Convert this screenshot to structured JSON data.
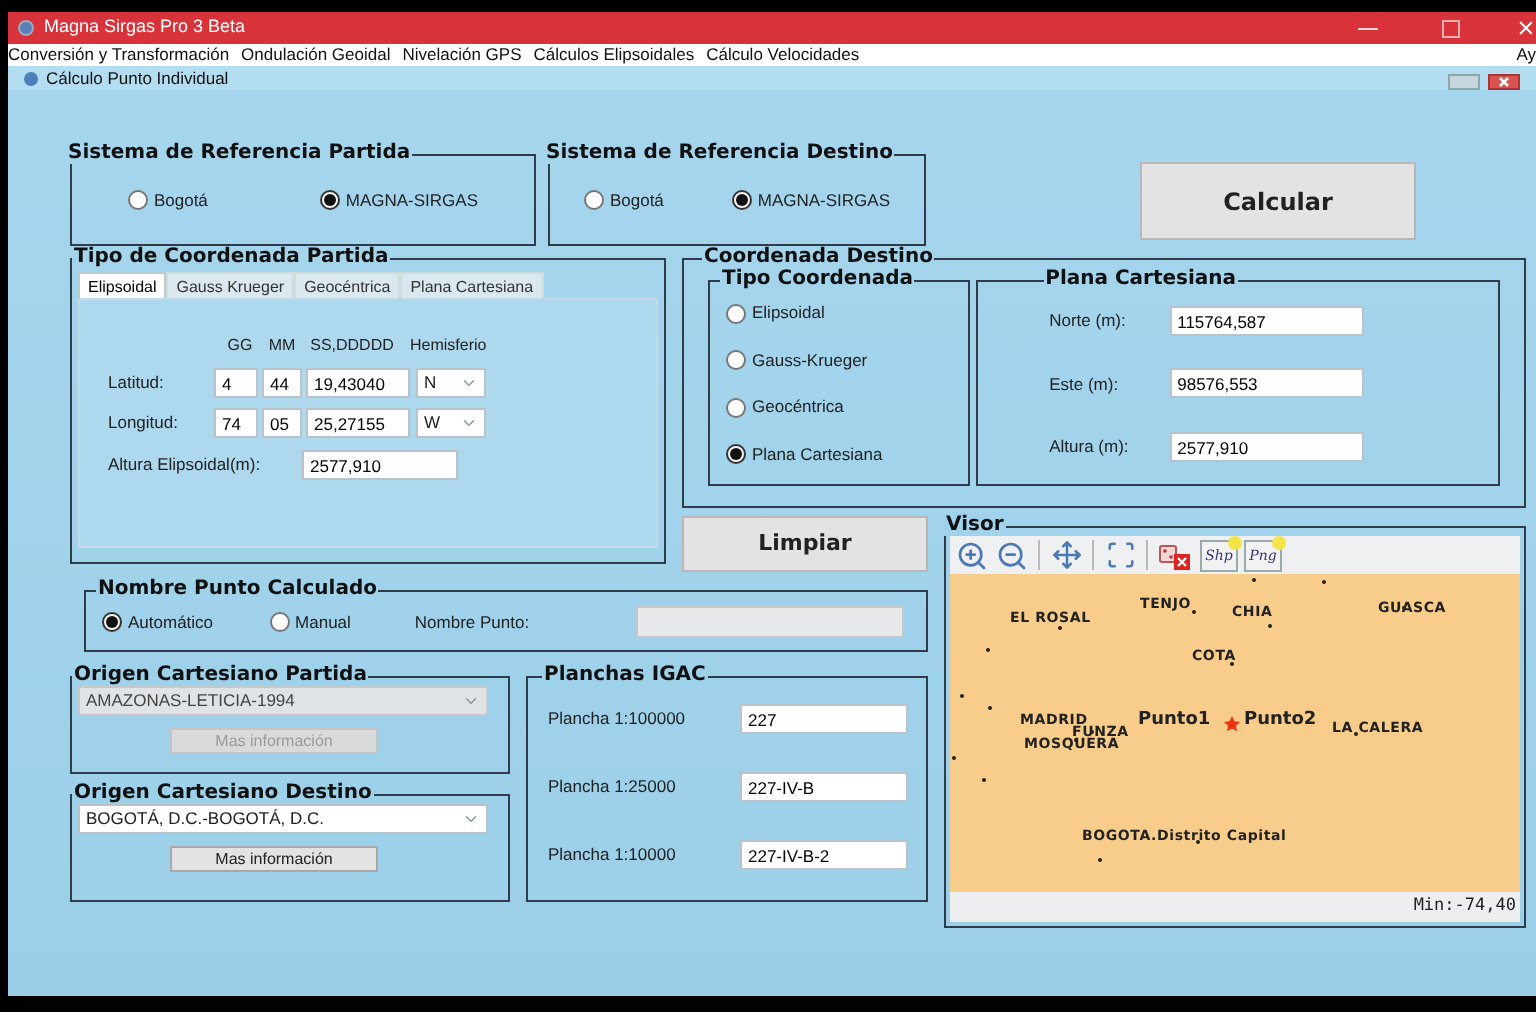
{
  "window": {
    "title": "Magna Sirgas Pro 3 Beta"
  },
  "menu": [
    "Conversión y Transformación",
    "Ondulación Geoidal",
    "Nivelación GPS",
    "Cálculos Elipsoidales",
    "Cálculo Velocidades",
    "Ay"
  ],
  "subwindow": {
    "title": "Cálculo Punto Individual"
  },
  "ref_partida": {
    "title": "Sistema de Referencia Partida",
    "options": [
      {
        "label": "Bogotá",
        "selected": false
      },
      {
        "label": "MAGNA-SIRGAS",
        "selected": true
      }
    ]
  },
  "ref_destino": {
    "title": "Sistema de Referencia Destino",
    "options": [
      {
        "label": "Bogotá",
        "selected": false
      },
      {
        "label": "MAGNA-SIRGAS",
        "selected": true
      }
    ]
  },
  "calcular": "Calcular",
  "tipo_partida": {
    "title": "Tipo de Coordenada Partida",
    "tabs": [
      {
        "label": "Elipsoidal",
        "selected": true
      },
      {
        "label": "Gauss Krueger",
        "selected": false
      },
      {
        "label": "Geocéntrica",
        "selected": false
      },
      {
        "label": "Plana Cartesiana",
        "selected": false
      }
    ],
    "headers": [
      "GG",
      "MM",
      "SS,DDDDD",
      "Hemisferio"
    ],
    "rows": [
      {
        "label": "Latitud:",
        "gg": "4",
        "mm": "44",
        "ss": "19,43040",
        "hemisferio": "N"
      },
      {
        "label": "Longitud:",
        "gg": "74",
        "mm": "05",
        "ss": "25,27155",
        "hemisferio": "W"
      }
    ],
    "altura": {
      "label": "Altura Elipsoidal(m):",
      "value": "2577,910"
    }
  },
  "destino": {
    "title": "Coordenada Destino",
    "tipo": {
      "title": "Tipo Coordenada",
      "options": [
        {
          "label": "Elipsoidal",
          "selected": false
        },
        {
          "label": "Gauss-Krueger",
          "selected": false
        },
        {
          "label": "Geocéntrica",
          "selected": false
        },
        {
          "label": "Plana Cartesiana",
          "selected": true
        }
      ]
    },
    "plana": {
      "title": "Plana Cartesiana",
      "fields": [
        {
          "label": "Norte (m):",
          "value": "115764,587"
        },
        {
          "label": "Este (m):",
          "value": "98576,553"
        },
        {
          "label": "Altura (m):",
          "value": "2577,910"
        }
      ]
    }
  },
  "limpiar": "Limpiar",
  "nombre_punto": {
    "title": "Nombre Punto Calculado",
    "options": [
      {
        "label": "Automático",
        "selected": true
      },
      {
        "label": "Manual",
        "selected": false
      }
    ],
    "field_label": "Nombre Punto:",
    "field_disabled": true
  },
  "origen_partida": {
    "title": "Origen Cartesiano Partida",
    "value": "AMAZONAS-LETICIA-1994",
    "button": "Mas información",
    "disabled": true
  },
  "origen_destino": {
    "title": "Origen Cartesiano Destino",
    "value": "BOGOTÁ, D.C.-BOGOTÁ, D.C.",
    "button": "Mas información",
    "disabled": false
  },
  "planchas": {
    "title": "Planchas IGAC",
    "rows": [
      {
        "label": "Plancha 1:100000",
        "value": "227"
      },
      {
        "label": "Plancha 1:25000",
        "value": "227-IV-B"
      },
      {
        "label": "Plancha 1:10000",
        "value": "227-IV-B-2"
      }
    ]
  },
  "visor": {
    "title": "Visor",
    "tools": [
      {
        "kind": "zoom-in"
      },
      {
        "kind": "zoom-out"
      },
      {
        "kind": "pan"
      },
      {
        "kind": "extent"
      },
      {
        "kind": "clear"
      },
      {
        "kind": "shp",
        "label": "Shp"
      },
      {
        "kind": "png",
        "label": "Png"
      }
    ],
    "labels": [
      {
        "text": "EL ROSAL",
        "kind": "town"
      },
      {
        "text": "TENJO",
        "kind": "town"
      },
      {
        "text": "CHIA",
        "kind": "town"
      },
      {
        "text": "GUASCA",
        "kind": "town"
      },
      {
        "text": "COTA",
        "kind": "town"
      },
      {
        "text": "MADRID",
        "kind": "town"
      },
      {
        "text": "FUNZA",
        "kind": "town"
      },
      {
        "text": "MOSQUERA",
        "kind": "town"
      },
      {
        "text": "Punto1",
        "kind": "point"
      },
      {
        "text": "Punto2",
        "kind": "point"
      },
      {
        "text": "LA CALERA",
        "kind": "town"
      },
      {
        "text": "BOGOTA.Distrito Capital",
        "kind": "town"
      }
    ],
    "status": "Min:-74,40"
  }
}
